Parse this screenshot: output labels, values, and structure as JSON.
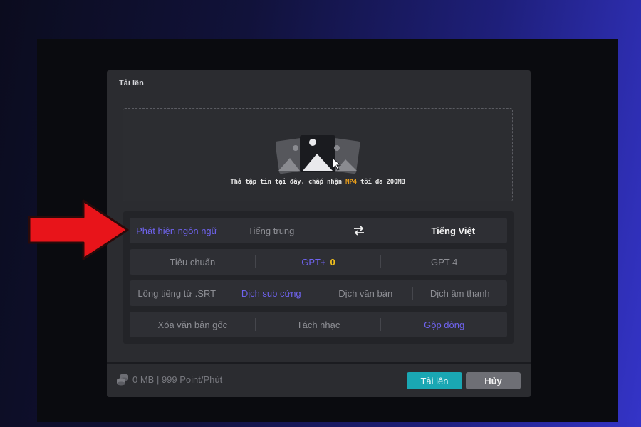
{
  "dialog": {
    "title": "Tải lên",
    "dropzone": {
      "text_before": "Thả tập tin tại đây, chấp nhận ",
      "highlight": "MP4",
      "text_after": " tối đa 200MB"
    }
  },
  "language_row": {
    "detect": "Phát hiện ngôn ngữ",
    "source": "Tiếng trung",
    "swap_icon": "swap-arrows-icon",
    "target": "Tiếng Việt"
  },
  "model_row": {
    "standard": "Tiêu chuẩn",
    "gpt_plus": "GPT+",
    "gpt_plus_count": "0",
    "gpt4": "GPT 4"
  },
  "mode_row": {
    "dub_srt": "Lồng tiếng từ .SRT",
    "hard_sub": "Dịch sub cứng",
    "translate_text": "Dịch văn bản",
    "translate_audio": "Dịch âm thanh"
  },
  "extra_row": {
    "remove_original": "Xóa văn bản gốc",
    "split_music": "Tách nhạc",
    "merge_lines": "Gộp dòng"
  },
  "footer": {
    "info": "0 MB | 999 Point/Phút",
    "upload_button": "Tải lên",
    "cancel_button": "Hủy"
  },
  "colors": {
    "accent_active": "#6f63ee",
    "upload_button": "#1aa7b3",
    "highlight": "#f0a21a",
    "gold": "#f2c01d",
    "annotation_arrow": "#e8141a"
  }
}
